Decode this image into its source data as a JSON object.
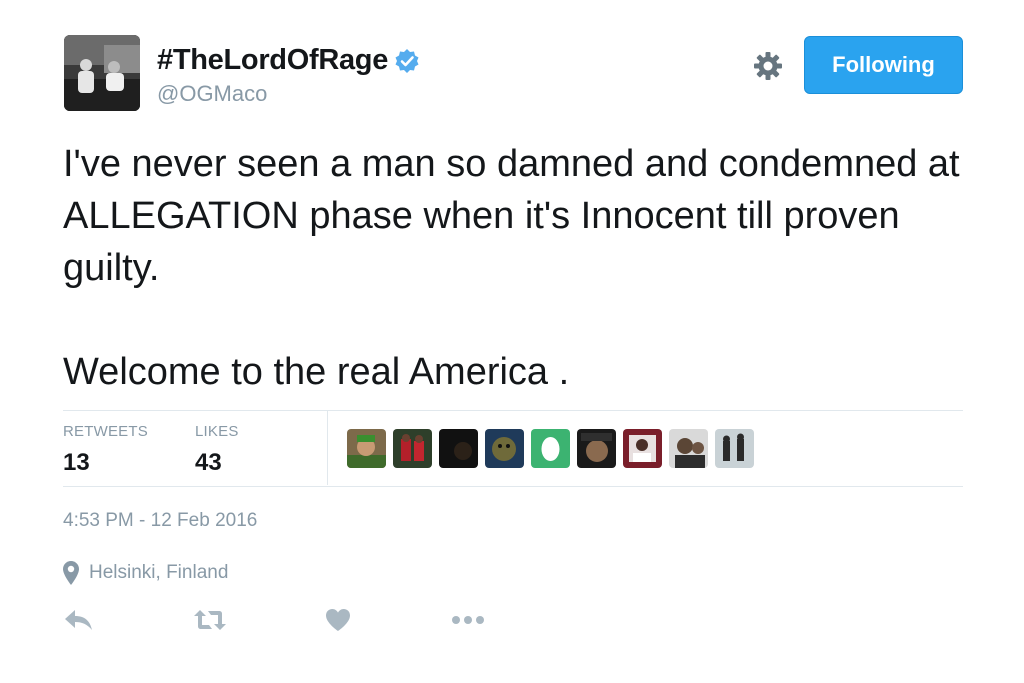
{
  "author": {
    "display_name": "#TheLordOfRage",
    "handle": "@OGMaco",
    "verified": true
  },
  "header": {
    "follow_button_label": "Following",
    "settings_icon": "gear-icon"
  },
  "tweet": {
    "paragraphs": [
      "I've never seen a man so damned and condemned at ALLEGATION phase when it's Innocent till proven guilty.",
      "Welcome to the real America ."
    ]
  },
  "stats": {
    "retweets_label": "RETWEETS",
    "retweets_count": "13",
    "likes_label": "LIKES",
    "likes_count": "43",
    "liker_avatar_count": 9
  },
  "meta": {
    "timestamp": "4:53 PM - 12 Feb 2016",
    "location": "Helsinki, Finland"
  },
  "actions": [
    "reply-icon",
    "retweet-icon",
    "like-icon",
    "more-icon"
  ],
  "colors": {
    "follow_button": "#2aa3ef",
    "verified_badge": "#55acee",
    "muted_text": "#8899a6",
    "action_icon": "#aab8c2"
  }
}
